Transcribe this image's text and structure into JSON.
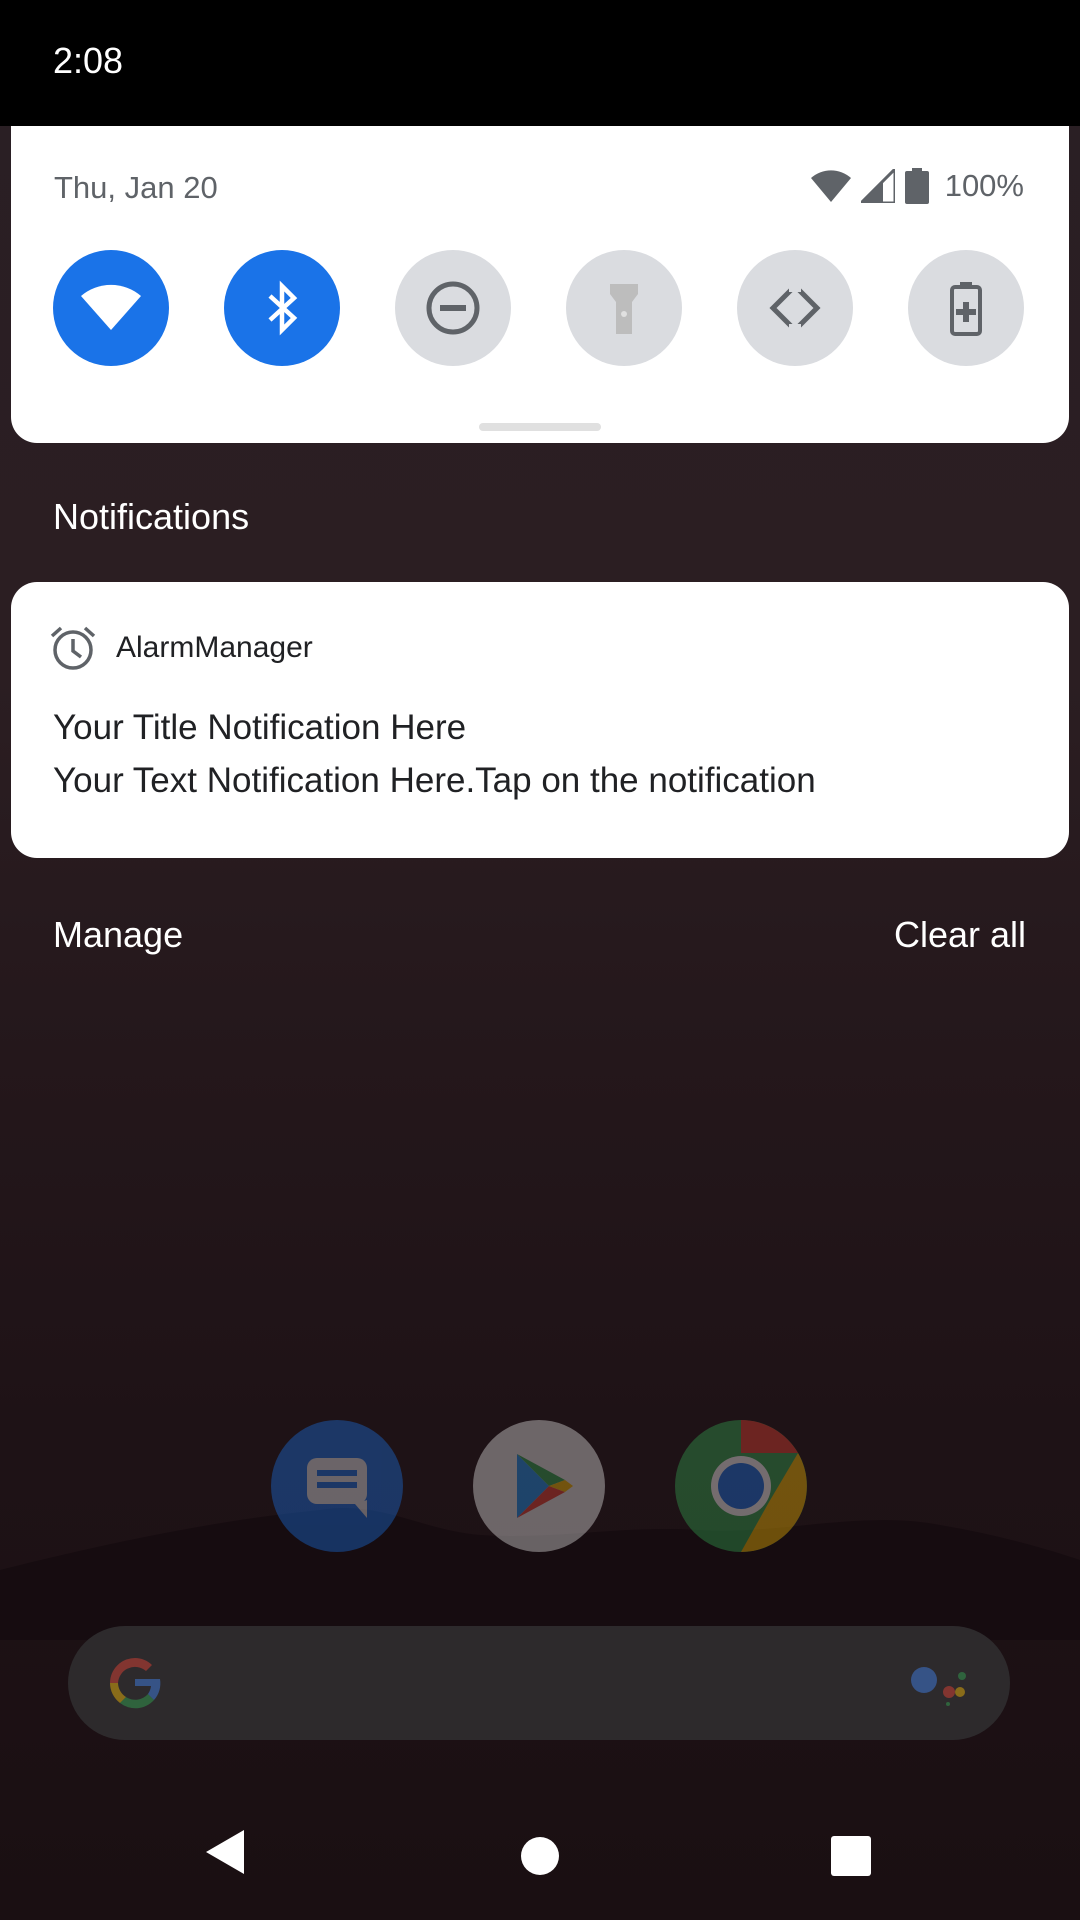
{
  "status_bar": {
    "time": "2:08"
  },
  "quick_settings": {
    "date": "Thu, Jan 20",
    "battery_percent": "100%",
    "tiles": [
      {
        "name": "wifi",
        "icon": "wifi-icon",
        "active": true
      },
      {
        "name": "bluetooth",
        "icon": "bluetooth-icon",
        "active": true
      },
      {
        "name": "do-not-disturb",
        "icon": "do-not-disturb-icon",
        "active": false
      },
      {
        "name": "flashlight",
        "icon": "flashlight-icon",
        "active": false
      },
      {
        "name": "auto-rotate",
        "icon": "auto-rotate-icon",
        "active": false
      },
      {
        "name": "battery-saver",
        "icon": "battery-saver-icon",
        "active": false
      }
    ]
  },
  "notifications": {
    "header": "Notifications",
    "items": [
      {
        "app_name": "AlarmManager",
        "icon": "alarm-clock-icon",
        "title": "Your Title Notification Here",
        "text": "Your Text Notification Here.Tap on the notification"
      }
    ],
    "manage_label": "Manage",
    "clear_all_label": "Clear all"
  },
  "home_screen": {
    "dock_icons": [
      "messages-icon",
      "play-store-icon",
      "chrome-icon"
    ],
    "search_bar": {
      "left_icon": "google-g-icon",
      "right_icon": "assistant-icon"
    }
  },
  "nav_bar": {
    "buttons": [
      "back-icon",
      "home-icon",
      "recents-icon"
    ]
  },
  "colors": {
    "tile_active": "#1a73e8",
    "tile_inactive": "#dadce0",
    "panel": "#ffffff",
    "scrim": "#2a1f24"
  }
}
